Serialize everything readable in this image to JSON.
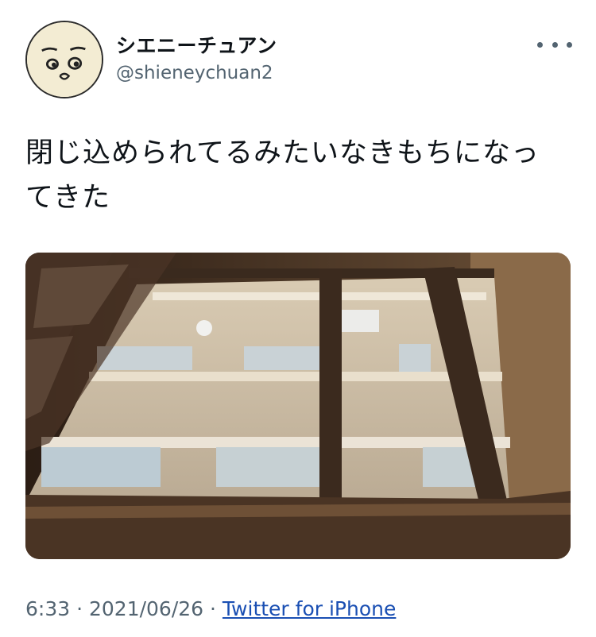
{
  "author": {
    "display_name": "シエニーチュアン",
    "handle": "@shieneychuan2"
  },
  "tweet": {
    "text": "閉じ込められてるみたいなきもちになってきた"
  },
  "meta": {
    "time": "6:33",
    "separator1": " · ",
    "date": "2021/06/26",
    "separator2": " · ",
    "source": "Twitter for iPhone"
  },
  "icons": {
    "more": "more-horizontal-icon",
    "avatar": "cartoon-face-avatar"
  },
  "colors": {
    "text_primary": "#0f1419",
    "text_secondary": "#536471",
    "link": "#1a4fb3"
  }
}
